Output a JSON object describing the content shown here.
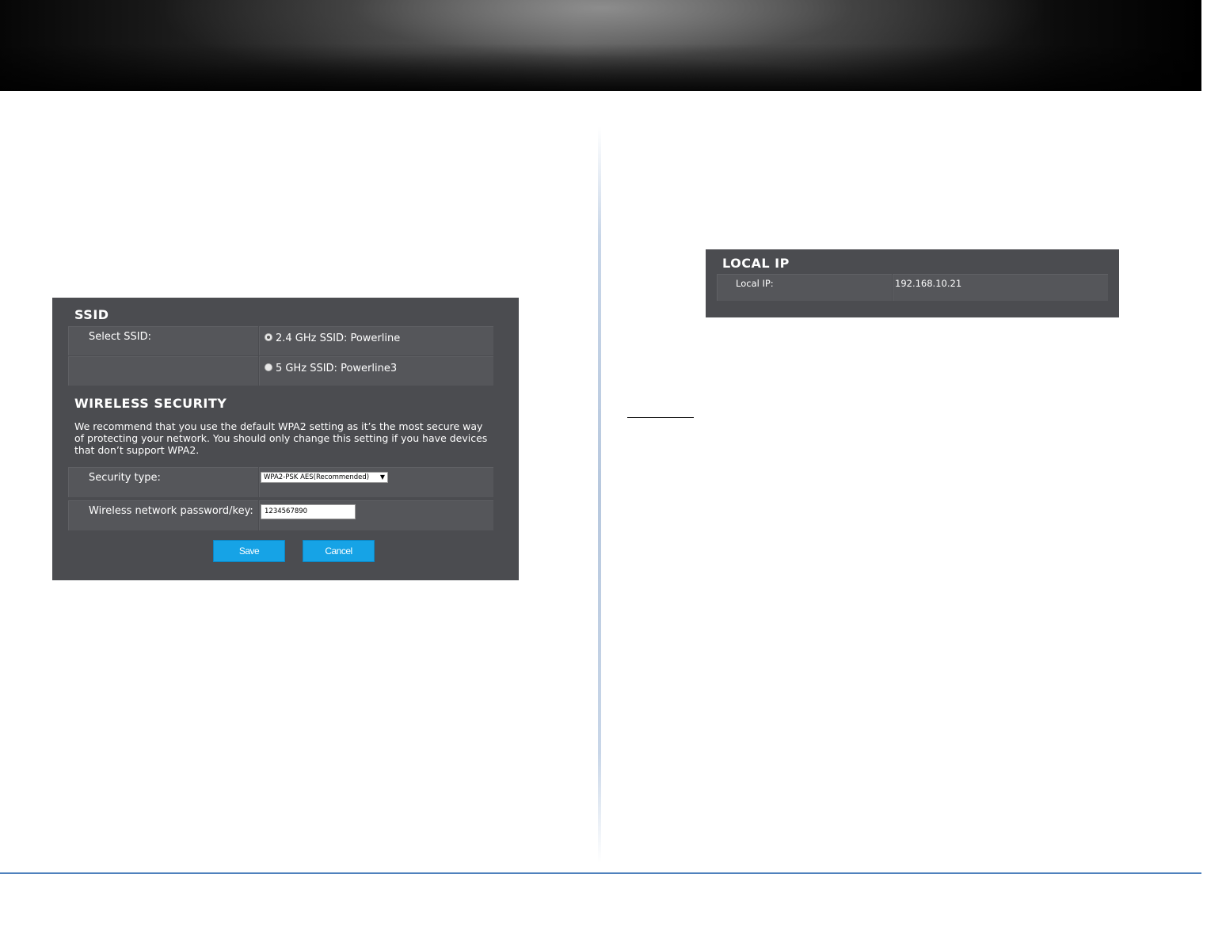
{
  "ssid_panel": {
    "title": "SSID",
    "select_ssid_label": "Select SSID:",
    "ssid_options": [
      {
        "label": "2.4 GHz SSID: Powerline",
        "checked": true
      },
      {
        "label": "5 GHz SSID: Powerline3",
        "checked": false
      }
    ]
  },
  "wireless_security": {
    "title": "WIRELESS SECURITY",
    "description": "We recommend that you use the default WPA2 setting as it’s the most secure way of protecting your network. You should only change this setting if you have devices that don’t support WPA2.",
    "security_type_label": "Security type:",
    "security_type_value": "WPA2-PSK AES(Recommended)",
    "password_label": "Wireless network password/key:",
    "password_value": "1234567890",
    "save_label": "Save",
    "cancel_label": "Cancel"
  },
  "local_ip_panel": {
    "title": "LOCAL IP",
    "label": "Local IP:",
    "value": "192.168.10.21"
  },
  "colors": {
    "panel_bg": "#4b4c50",
    "button_blue": "#16a3e6",
    "footer_rule": "#4f81bd"
  }
}
